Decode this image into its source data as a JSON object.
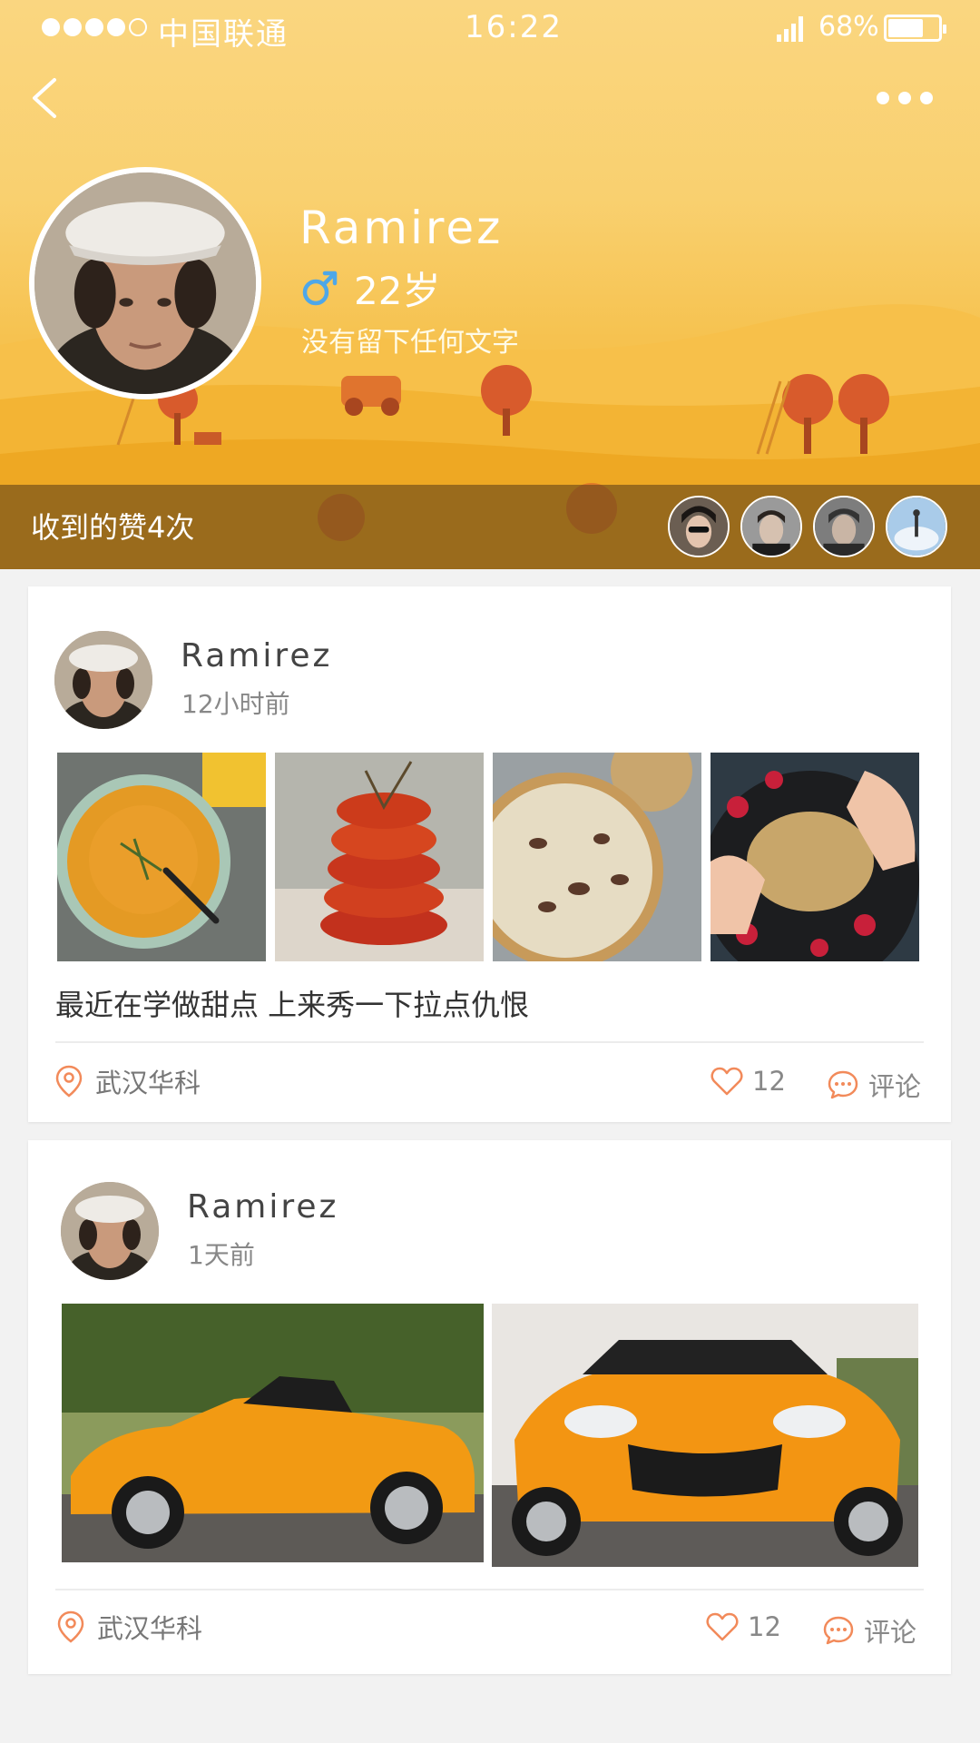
{
  "status_bar": {
    "carrier": "中国联通",
    "time": "16:22",
    "battery": "68%"
  },
  "profile": {
    "name": "Ramirez",
    "age": "22岁",
    "bio": "没有留下任何文字",
    "likes_text": "收到的赞4次",
    "gender_color": "#4ea7e8"
  },
  "posts": [
    {
      "author": "Ramirez",
      "time": "12小时前",
      "text": "最近在学做甜点 上来秀一下拉点仇恨",
      "location": "武汉华科",
      "likes": "12",
      "comment_label": "评论",
      "photos": [
        "pumpkin soup",
        "roasted tomatoes",
        "mushroom tart",
        "berry crumble"
      ]
    },
    {
      "author": "Ramirez",
      "time": "1天前",
      "location": "武汉华科",
      "likes": "12",
      "comment_label": "评论",
      "photos": [
        "orange roadster side",
        "orange roadster front"
      ]
    }
  ],
  "colors": {
    "accent": "#f28a5a",
    "header_yellow": "#f9cf6c",
    "likes_bar": "#66461899"
  }
}
